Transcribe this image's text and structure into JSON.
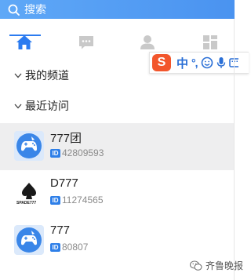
{
  "search": {
    "label": "搜索",
    "icon": "search-icon"
  },
  "tabs": [
    {
      "name": "home",
      "icon": "home-icon",
      "active": true
    },
    {
      "name": "messages",
      "icon": "chat-icon",
      "active": false
    },
    {
      "name": "contacts",
      "icon": "user-icon",
      "active": false
    },
    {
      "name": "apps",
      "icon": "grid-icon",
      "active": false
    }
  ],
  "ime_toolbar": {
    "logo": "S",
    "mode": "中",
    "punct": "°,",
    "icons": [
      "emoji-icon",
      "microphone-icon",
      "keyboard-icon"
    ]
  },
  "sections": {
    "my_channels": "我的频道",
    "recent": "最近访问"
  },
  "recent_items": [
    {
      "title": "777团",
      "id_badge": "ID",
      "id": "42809593",
      "selected": true,
      "avatar": "game-avatar"
    },
    {
      "title": "D777",
      "id_badge": "ID",
      "id": "11274565",
      "selected": false,
      "avatar": "spade-logo-avatar",
      "avatar_text": "SPADE777"
    },
    {
      "title": "777",
      "id_badge": "ID",
      "id": "80807",
      "selected": false,
      "avatar": "game-avatar"
    }
  ],
  "watermark": {
    "text": "齐鲁晚报"
  },
  "colors": {
    "accent": "#2b7bf0",
    "search_bg": "#4a93f0",
    "ime_logo": "#f2562c",
    "selected_row": "#eeeeef"
  }
}
